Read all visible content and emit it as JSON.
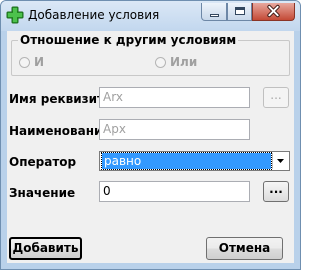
{
  "window": {
    "title": "Добавление условия"
  },
  "relation_group": {
    "title": "Отношение к другим условиям",
    "options": [
      {
        "label": "И",
        "selected": false,
        "enabled": false
      },
      {
        "label": "Или",
        "selected": false,
        "enabled": false
      }
    ]
  },
  "form": {
    "requisite": {
      "label": "Имя реквизита",
      "value": "Arx",
      "browse_label": "..."
    },
    "name": {
      "label": "Наименование",
      "value": "Apx"
    },
    "operator": {
      "label": "Оператор",
      "value": "равно"
    },
    "value": {
      "label": "Значение",
      "value": "0",
      "browse_label": "..."
    }
  },
  "buttons": {
    "add": "Добавить",
    "cancel": "Отмена"
  },
  "colors": {
    "title_bar": "#c9dcf0",
    "close_button": "#c44a36",
    "selection": "#3399ff",
    "icon_green": "#2e9f2e"
  }
}
